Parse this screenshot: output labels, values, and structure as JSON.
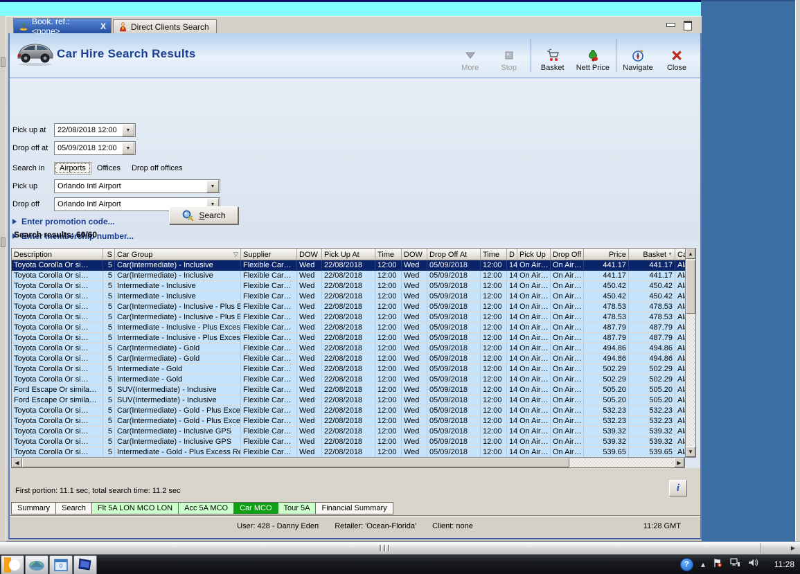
{
  "colors": {
    "cyan": "#80ffff",
    "desktop_blue": "#3c6da3",
    "title_navy": "#1b3f94",
    "selected_row": "#0a246a",
    "active_tab_green": "#0fa015",
    "light_green": "#ccffcc"
  },
  "tab_bar": {
    "tabs": [
      {
        "label": "Book. ref.: <none>",
        "icon": "palm-tree-icon",
        "active": true,
        "close": "X"
      },
      {
        "label": "Direct Clients Search",
        "icon": "person-icon",
        "active": false
      }
    ]
  },
  "header": {
    "title": "Car Hire Search Results",
    "icon": "car-image"
  },
  "toolbar": {
    "buttons": [
      {
        "label": "More",
        "icon": "down-arrow-icon",
        "enabled": false
      },
      {
        "label": "Stop",
        "icon": "stop-icon",
        "enabled": false
      },
      {
        "label": "Basket",
        "icon": "shopping-cart-icon",
        "enabled": true
      },
      {
        "label": "Nett Price",
        "icon": "money-bag-icon",
        "enabled": true
      },
      {
        "label": "Navigate",
        "icon": "compass-icon",
        "enabled": true
      },
      {
        "label": "Close",
        "icon": "red-x-icon",
        "enabled": true
      }
    ]
  },
  "form": {
    "pickup_at": {
      "label": "Pick up at",
      "value": "22/08/2018 12:00"
    },
    "dropoff_at": {
      "label": "Drop off at",
      "value": "05/09/2018 12:00"
    },
    "search_in": {
      "label": "Search in",
      "options": [
        "Airports",
        "Offices",
        "Drop off offices"
      ],
      "selected": "Airports"
    },
    "pickup": {
      "label": "Pick up",
      "value": "Orlando Intl Airport"
    },
    "dropoff": {
      "label": "Drop off",
      "value": "Orlando Intl Airport"
    },
    "promotion": "Enter promotion code...",
    "membership": "Enter membership number...",
    "search_button": "Search"
  },
  "results": {
    "summary": "Search results: 60/60",
    "columns": [
      "Description",
      "S",
      "Car Group",
      "Supplier",
      "DOW",
      "Pick Up At",
      "Time",
      "DOW",
      "Drop Off At",
      "Time",
      "D",
      "Pick Up",
      "Drop Off",
      "Price",
      "Basket",
      "Ca"
    ],
    "selected_row": 0,
    "rows": [
      [
        "Toyota Corolla Or si…",
        "5",
        "Car(Intermediate) - Inclusive",
        "Flexible Car…",
        "Wed",
        "22/08/2018",
        "12:00",
        "Wed",
        "05/09/2018",
        "12:00",
        "14",
        "On Air…",
        "On Air…",
        "441.17",
        "441.17",
        "Ala"
      ],
      [
        "Toyota Corolla Or si…",
        "5",
        "Car(Intermediate) - Inclusive",
        "Flexible Car…",
        "Wed",
        "22/08/2018",
        "12:00",
        "Wed",
        "05/09/2018",
        "12:00",
        "14",
        "On Air…",
        "On Air…",
        "441.17",
        "441.17",
        "Ala"
      ],
      [
        "Toyota Corolla Or si…",
        "5",
        "Intermediate - Inclusive",
        "Flexible Car…",
        "Wed",
        "22/08/2018",
        "12:00",
        "Wed",
        "05/09/2018",
        "12:00",
        "14",
        "On Air…",
        "On Air…",
        "450.42",
        "450.42",
        "Ala"
      ],
      [
        "Toyota Corolla Or si…",
        "5",
        "Intermediate - Inclusive",
        "Flexible Car…",
        "Wed",
        "22/08/2018",
        "12:00",
        "Wed",
        "05/09/2018",
        "12:00",
        "14",
        "On Air…",
        "On Air…",
        "450.42",
        "450.42",
        "Ala"
      ],
      [
        "Toyota Corolla Or si…",
        "5",
        "Car(Intermediate) - Inclusive - Plus E…",
        "Flexible Car…",
        "Wed",
        "22/08/2018",
        "12:00",
        "Wed",
        "05/09/2018",
        "12:00",
        "14",
        "On Air…",
        "On Air…",
        "478.53",
        "478.53",
        "Ala"
      ],
      [
        "Toyota Corolla Or si…",
        "5",
        "Car(Intermediate) - Inclusive - Plus E…",
        "Flexible Car…",
        "Wed",
        "22/08/2018",
        "12:00",
        "Wed",
        "05/09/2018",
        "12:00",
        "14",
        "On Air…",
        "On Air…",
        "478.53",
        "478.53",
        "Ala"
      ],
      [
        "Toyota Corolla Or si…",
        "5",
        "Intermediate - Inclusive - Plus Excess …",
        "Flexible Car…",
        "Wed",
        "22/08/2018",
        "12:00",
        "Wed",
        "05/09/2018",
        "12:00",
        "14",
        "On Air…",
        "On Air…",
        "487.79",
        "487.79",
        "Ala"
      ],
      [
        "Toyota Corolla Or si…",
        "5",
        "Intermediate - Inclusive - Plus Excess …",
        "Flexible Car…",
        "Wed",
        "22/08/2018",
        "12:00",
        "Wed",
        "05/09/2018",
        "12:00",
        "14",
        "On Air…",
        "On Air…",
        "487.79",
        "487.79",
        "Ala"
      ],
      [
        "Toyota Corolla Or si…",
        "5",
        "Car(Intermediate) - Gold",
        "Flexible Car…",
        "Wed",
        "22/08/2018",
        "12:00",
        "Wed",
        "05/09/2018",
        "12:00",
        "14",
        "On Air…",
        "On Air…",
        "494.86",
        "494.86",
        "Ala"
      ],
      [
        "Toyota Corolla Or si…",
        "5",
        "Car(Intermediate) - Gold",
        "Flexible Car…",
        "Wed",
        "22/08/2018",
        "12:00",
        "Wed",
        "05/09/2018",
        "12:00",
        "14",
        "On Air…",
        "On Air…",
        "494.86",
        "494.86",
        "Ala"
      ],
      [
        "Toyota Corolla Or si…",
        "5",
        "Intermediate - Gold",
        "Flexible Car…",
        "Wed",
        "22/08/2018",
        "12:00",
        "Wed",
        "05/09/2018",
        "12:00",
        "14",
        "On Air…",
        "On Air…",
        "502.29",
        "502.29",
        "Ala"
      ],
      [
        "Toyota Corolla Or si…",
        "5",
        "Intermediate - Gold",
        "Flexible Car…",
        "Wed",
        "22/08/2018",
        "12:00",
        "Wed",
        "05/09/2018",
        "12:00",
        "14",
        "On Air…",
        "On Air…",
        "502.29",
        "502.29",
        "Ala"
      ],
      [
        "Ford Escape Or simila…",
        "5",
        "SUV(Intermediate) - Inclusive",
        "Flexible Car…",
        "Wed",
        "22/08/2018",
        "12:00",
        "Wed",
        "05/09/2018",
        "12:00",
        "14",
        "On Air…",
        "On Air…",
        "505.20",
        "505.20",
        "Ala"
      ],
      [
        "Ford Escape Or simila…",
        "5",
        "SUV(Intermediate) - Inclusive",
        "Flexible Car…",
        "Wed",
        "22/08/2018",
        "12:00",
        "Wed",
        "05/09/2018",
        "12:00",
        "14",
        "On Air…",
        "On Air…",
        "505.20",
        "505.20",
        "Ala"
      ],
      [
        "Toyota Corolla Or si…",
        "5",
        "Car(Intermediate) - Gold - Plus Exces…",
        "Flexible Car…",
        "Wed",
        "22/08/2018",
        "12:00",
        "Wed",
        "05/09/2018",
        "12:00",
        "14",
        "On Air…",
        "On Air…",
        "532.23",
        "532.23",
        "Ala"
      ],
      [
        "Toyota Corolla Or si…",
        "5",
        "Car(Intermediate) - Gold - Plus Exces…",
        "Flexible Car…",
        "Wed",
        "22/08/2018",
        "12:00",
        "Wed",
        "05/09/2018",
        "12:00",
        "14",
        "On Air…",
        "On Air…",
        "532.23",
        "532.23",
        "Ala"
      ],
      [
        "Toyota Corolla Or si…",
        "5",
        "Car(Intermediate) - Inclusive GPS",
        "Flexible Car…",
        "Wed",
        "22/08/2018",
        "12:00",
        "Wed",
        "05/09/2018",
        "12:00",
        "14",
        "On Air…",
        "On Air…",
        "539.32",
        "539.32",
        "Ala"
      ],
      [
        "Toyota Corolla Or si…",
        "5",
        "Car(Intermediate) - Inclusive GPS",
        "Flexible Car…",
        "Wed",
        "22/08/2018",
        "12:00",
        "Wed",
        "05/09/2018",
        "12:00",
        "14",
        "On Air…",
        "On Air…",
        "539.32",
        "539.32",
        "Ala"
      ],
      [
        "Toyota Corolla Or si…",
        "5",
        "Intermediate - Gold - Plus Excess Ref…",
        "Flexible Car…",
        "Wed",
        "22/08/2018",
        "12:00",
        "Wed",
        "05/09/2018",
        "12:00",
        "14",
        "On Air…",
        "On Air…",
        "539.65",
        "539.65",
        "Ala"
      ]
    ]
  },
  "footer": {
    "timing": "First portion: 11.1 sec, total search time: 11.2 sec",
    "info_button": "i",
    "tabs": [
      {
        "label": "Summary",
        "style": "plain"
      },
      {
        "label": "Search",
        "style": "plain"
      },
      {
        "label": "Flt 5A LON MCO LON",
        "style": "green"
      },
      {
        "label": "Acc 5A MCO",
        "style": "green"
      },
      {
        "label": "Car MCO",
        "style": "active-green"
      },
      {
        "label": "Tour 5A",
        "style": "green"
      },
      {
        "label": "Financial Summary",
        "style": "plain"
      }
    ],
    "status": {
      "user": "User: 428 - Danny Eden",
      "retailer": "Retailer: 'Ocean-Florida'",
      "client": "Client: none",
      "time": "11:28 GMT"
    }
  },
  "taskbar": {
    "clock": "11:28"
  }
}
